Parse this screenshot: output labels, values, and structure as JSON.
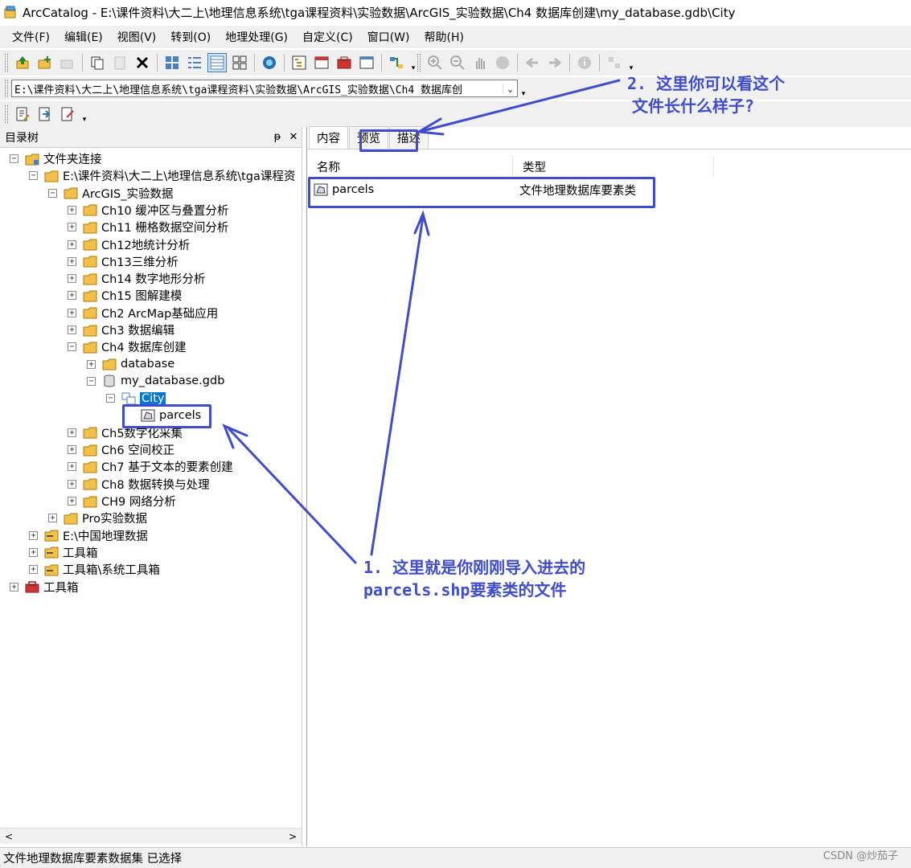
{
  "window": {
    "title": "ArcCatalog - E:\\课件资料\\大二上\\地理信息系统\\tga课程资料\\实验数据\\ArcGIS_实验数据\\Ch4 数据库创建\\my_database.gdb\\City"
  },
  "menu": [
    "文件(F)",
    "编辑(E)",
    "视图(V)",
    "转到(O)",
    "地理处理(G)",
    "自定义(C)",
    "窗口(W)",
    "帮助(H)"
  ],
  "location": {
    "value": "E:\\课件资料\\大二上\\地理信息系统\\tga课程资料\\实验数据\\ArcGIS_实验数据\\Ch4 数据库创"
  },
  "catalog_tree": {
    "title": "目录树",
    "pin": "ᵽ",
    "close": "✕",
    "items": [
      {
        "label": "文件夹连接",
        "expander": "−",
        "icon": "folder-connections-icon"
      },
      {
        "label": "E:\\课件资料\\大二上\\地理信息系统\\tga课程资",
        "expander": "−",
        "icon": "folder-icon"
      },
      {
        "label": "ArcGIS_实验数据",
        "expander": "−",
        "icon": "folder-icon"
      },
      {
        "label": "Ch10 缓冲区与叠置分析",
        "expander": "+",
        "icon": "folder-icon"
      },
      {
        "label": "Ch11 栅格数据空间分析",
        "expander": "+",
        "icon": "folder-icon"
      },
      {
        "label": "Ch12地统计分析",
        "expander": "+",
        "icon": "folder-icon"
      },
      {
        "label": "Ch13三维分析",
        "expander": "+",
        "icon": "folder-icon"
      },
      {
        "label": "Ch14 数字地形分析",
        "expander": "+",
        "icon": "folder-icon"
      },
      {
        "label": "Ch15 图解建模",
        "expander": "+",
        "icon": "folder-icon"
      },
      {
        "label": "Ch2  ArcMap基础应用",
        "expander": "+",
        "icon": "folder-icon"
      },
      {
        "label": "Ch3 数据编辑",
        "expander": "+",
        "icon": "folder-icon"
      },
      {
        "label": "Ch4 数据库创建",
        "expander": "−",
        "icon": "folder-icon"
      },
      {
        "label": "database",
        "expander": "+",
        "icon": "folder-icon"
      },
      {
        "label": "my_database.gdb",
        "expander": "−",
        "icon": "geodatabase-icon"
      },
      {
        "label": "City",
        "expander": "−",
        "icon": "feature-dataset-icon",
        "selected": true
      },
      {
        "label": "parcels",
        "expander": "",
        "icon": "polygon-feature-class-icon"
      },
      {
        "label": "Ch5数字化采集",
        "expander": "+",
        "icon": "folder-icon"
      },
      {
        "label": "Ch6 空间校正",
        "expander": "+",
        "icon": "folder-icon"
      },
      {
        "label": "Ch7 基于文本的要素创建",
        "expander": "+",
        "icon": "folder-icon"
      },
      {
        "label": "Ch8 数据转换与处理",
        "expander": "+",
        "icon": "folder-icon"
      },
      {
        "label": "CH9 网络分析",
        "expander": "+",
        "icon": "folder-icon"
      },
      {
        "label": "Pro实验数据",
        "expander": "+",
        "icon": "folder-icon"
      },
      {
        "label": "E:\\中国地理数据",
        "expander": "+",
        "icon": "folder-connection-icon"
      },
      {
        "label": "工具箱",
        "expander": "+",
        "icon": "folder-connection-icon"
      },
      {
        "label": "工具箱\\系统工具箱",
        "expander": "+",
        "icon": "folder-connection-icon"
      },
      {
        "label": "工具箱",
        "expander": "+",
        "icon": "toolbox-icon"
      }
    ]
  },
  "content": {
    "tabs": [
      "内容",
      "预览",
      "描述"
    ],
    "active_tab": "内容",
    "columns": [
      "名称",
      "类型"
    ],
    "rows": [
      {
        "name": "parcels",
        "type": "文件地理数据库要素类"
      }
    ]
  },
  "status": {
    "text": "文件地理数据库要素数据集 已选择"
  },
  "watermark": "CSDN @炒茄子",
  "annotations": {
    "note1_line1": "1. 这里就是你刚刚导入进去的",
    "note1_line2": "parcels.shp要素类的文件",
    "note2_line1": "2. 这里你可以看这个",
    "note2_line2": "文件长什么样子?"
  },
  "colors": {
    "annotation": "#3f4dcc",
    "selection": "#0078d7",
    "folder": "#f3c04a"
  }
}
